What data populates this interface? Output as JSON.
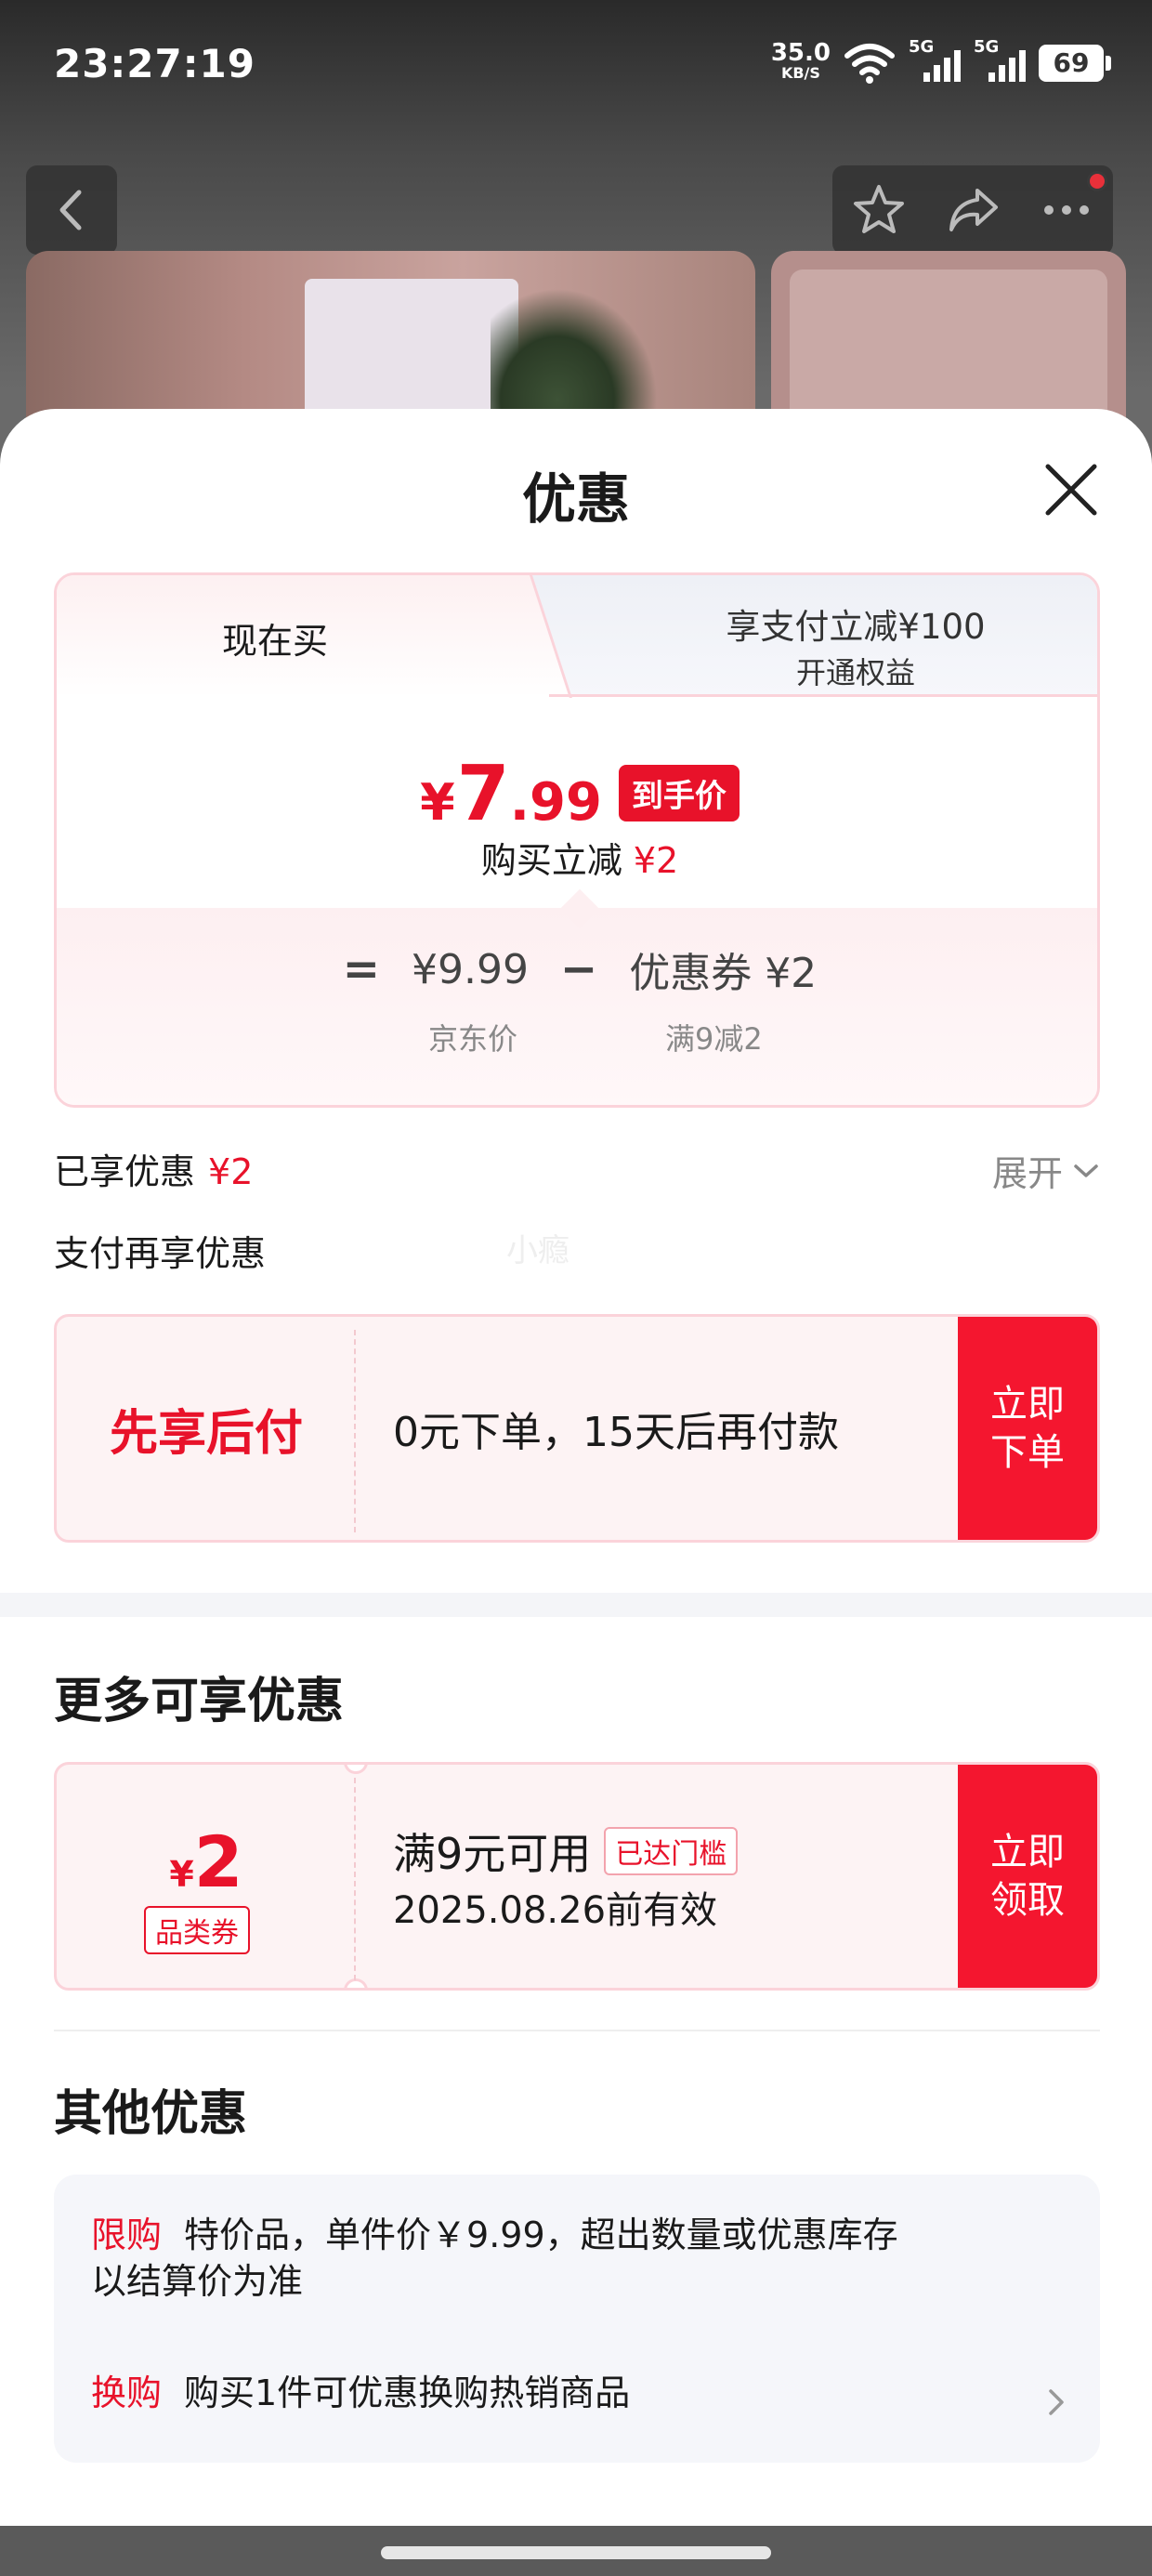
{
  "status_bar": {
    "time": "23:27:19",
    "net_speed": "35.0",
    "net_unit": "KB/S",
    "signal1_label": "5G",
    "signal2_label": "5G",
    "battery": "69"
  },
  "sheet": {
    "title": "优惠"
  },
  "tabs": {
    "buy_now": "现在买",
    "pay_offer": "享支付立减¥100",
    "pay_offer_sub": "开通权益"
  },
  "price": {
    "yen": "¥",
    "integer": "7",
    "decimal": ".99",
    "badge": "到手价",
    "buy_reduce_label": "购买立减",
    "buy_reduce_value": "¥2",
    "calc": {
      "equals": "=",
      "jd_price": "¥9.99",
      "minus": "−",
      "coupon": "优惠券 ¥2",
      "jd_price_label": "京东价",
      "coupon_label": "满9减2"
    }
  },
  "summary": {
    "enjoyed_label": "已享优惠",
    "enjoyed_value": "¥2",
    "expand": "展开",
    "pay_again": "支付再享优惠",
    "watermark": "小瘾"
  },
  "bnpl": {
    "title": "先享后付",
    "desc": "0元下单，15天后再付款",
    "btn_line1": "立即",
    "btn_line2": "下单"
  },
  "more": {
    "title": "更多可享优惠",
    "coupon": {
      "yen": "¥",
      "amount": "2",
      "tag": "品类券",
      "condition": "满9元可用",
      "reached": "已达门槛",
      "expiry": "2025.08.26前有效",
      "btn_line1": "立即",
      "btn_line2": "领取"
    }
  },
  "other": {
    "title": "其他优惠",
    "rows": [
      {
        "tag": "限购",
        "text": "特价品，单件价￥9.99，超出数量或优惠库存",
        "text2": "以结算价为准"
      },
      {
        "tag": "换购",
        "text": "购买1件可优惠换购热销商品"
      }
    ]
  }
}
